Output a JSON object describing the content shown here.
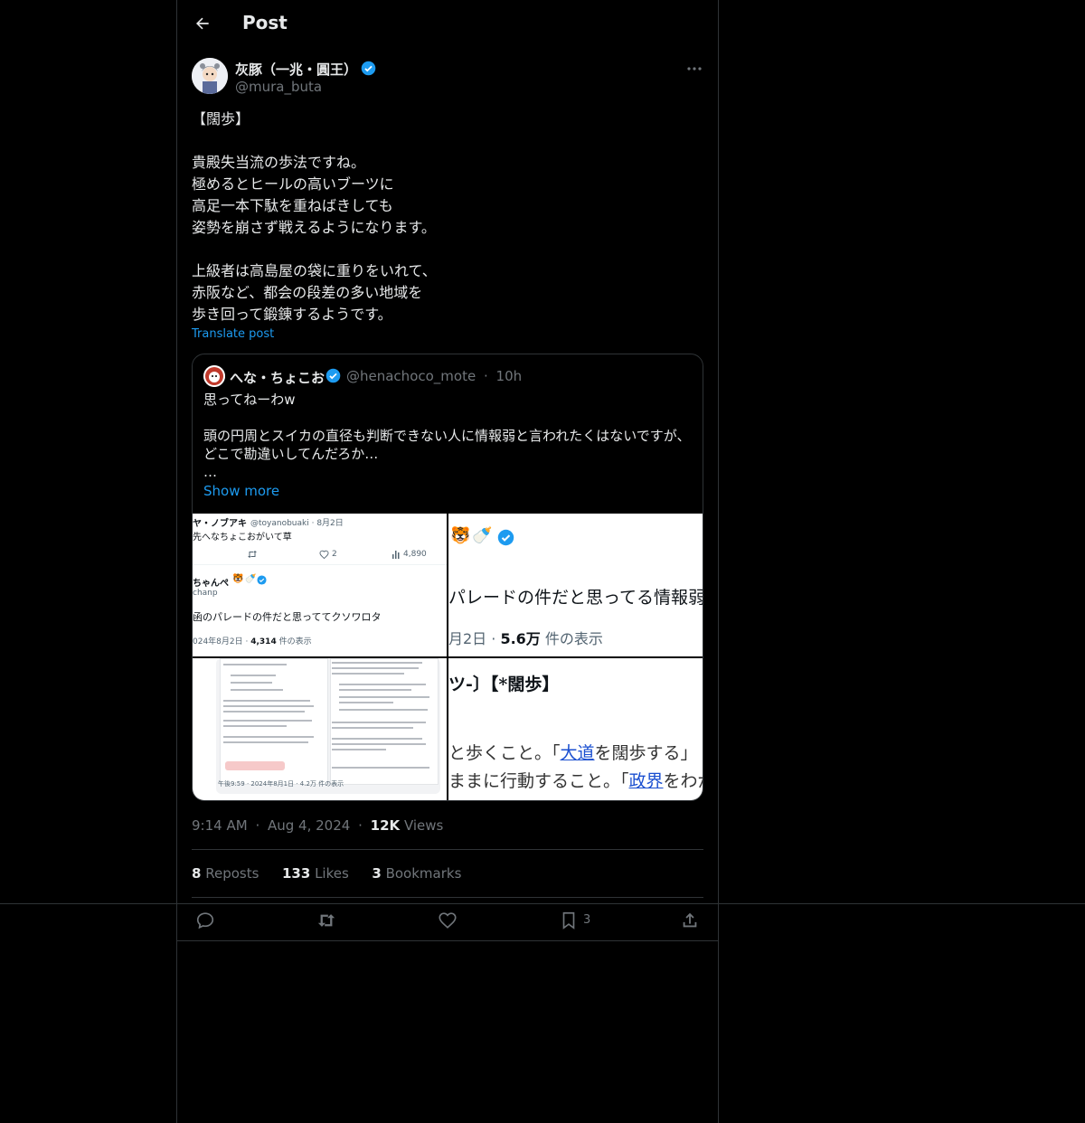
{
  "header": {
    "title": "Post"
  },
  "post": {
    "display_name": "灰豚（一兆・圓王）",
    "handle": "@mura_buta",
    "text": "【闊歩】\n\n貴殿失当流の歩法ですね。\n極めるとヒールの高いブーツに\n高足一本下駄を重ねばきしても\n姿勢を崩さず戦えるようになります。\n\n上級者は高島屋の袋に重りをいれて、\n赤阪など、都会の段差の多い地域を\n歩き回って鍛錬するようです。",
    "translate_label": "Translate post",
    "time": "9:14 AM",
    "date": "Aug 4, 2024",
    "views_count": "12K",
    "views_label": "Views",
    "reposts_count": "8",
    "reposts_label": "Reposts",
    "likes_count": "133",
    "likes_label": "Likes",
    "bookmarks_count": "3",
    "bookmarks_label": "Bookmarks"
  },
  "quote": {
    "display_name": "へな・ちょこお",
    "handle": "@henachoco_mote",
    "separator": "·",
    "age": "10h",
    "text": "思ってねーわw\n\n頭の円周とスイカの直径も判断できない人に情報弱と言われたくはないですが、どこで勘違いしてんだろか…\n…",
    "show_more": "Show more",
    "media": {
      "tile1": {
        "line1_name": "ヤ・ノブアキ",
        "line1_meta": "@toyanobuaki · 8月2日",
        "line2": "先へなちょこおがいて草",
        "likes": "2",
        "views": "4,890",
        "user2_name": "ちゃんぺ",
        "user2_handle": "chanp",
        "body": "函のパレードの件だと思っててクソワロタ",
        "footer_date": "024年8月2日 ·",
        "footer_views": "4,314",
        "footer_views_label": "件の表示"
      },
      "tile2": {
        "body": "パレードの件だと思ってる情報弱が居",
        "footer_date": "月2日 ·",
        "footer_views": "5.6万",
        "footer_views_label": "件の表示"
      },
      "tile3": {
        "footer": "午後9:59 · 2024年8月1日 · 4.2万 件の表示"
      },
      "tile4": {
        "heading": "ツ-〕【*闊歩】",
        "line1_pre": "と歩くこと。「",
        "line1_link": "大道",
        "line1_post": "を闊歩する」",
        "line2_pre": "ままに行動すること。「",
        "line2_link": "政界",
        "line2_post": "をわが物"
      }
    }
  },
  "actions": {
    "bookmark_count": "3"
  },
  "colors": {
    "accent": "#1d9bf0",
    "muted": "#71767b",
    "border": "#2f3336"
  }
}
